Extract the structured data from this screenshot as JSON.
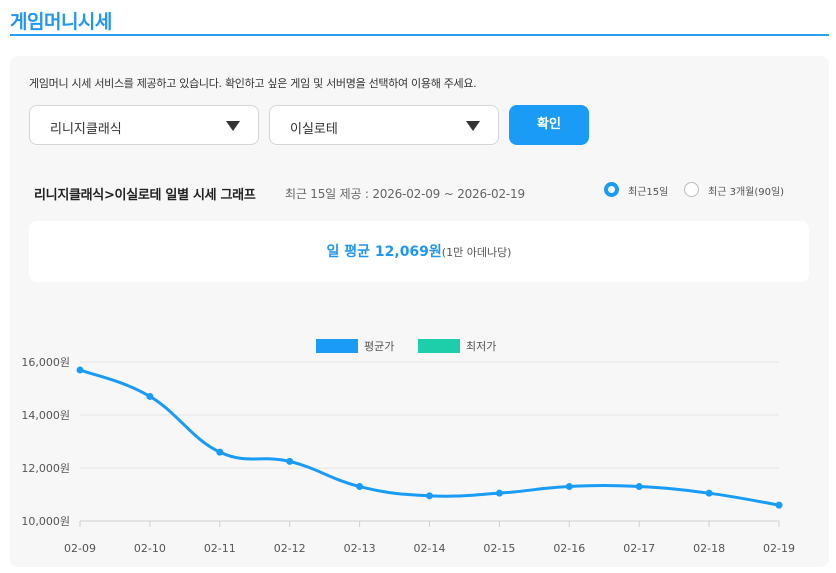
{
  "page": {
    "title": "게임머니시세"
  },
  "panel": {
    "description": "게임머니 시세 서비스를 제공하고 있습니다. 확인하고 싶은 게임 및 서버명을 선택하여 이용해 주세요.",
    "game_select": {
      "value": "리니지클래식"
    },
    "server_select": {
      "value": "이실로테"
    },
    "confirm_label": "확인"
  },
  "graph": {
    "title": "리니지클래식>이실로테 일별 시세 그래프",
    "subtitle": "최근 15일 제공 : 2026-02-09 ~ 2026-02-19",
    "radio_15": "최근15일",
    "radio_90": "최근 3개월(90일)",
    "selected_range": "최근15일"
  },
  "average": {
    "main": "일 평균 12,069원",
    "unit": "(1만 아데나당)"
  },
  "chart_data": {
    "type": "line",
    "x": [
      "02-09",
      "02-10",
      "02-11",
      "02-12",
      "02-13",
      "02-14",
      "02-15",
      "02-16",
      "02-17",
      "02-18",
      "02-19"
    ],
    "series": [
      {
        "name": "평균가",
        "color": "#1a9bf6",
        "values": [
          15700,
          14700,
          12600,
          12250,
          11300,
          10950,
          11050,
          11300,
          11300,
          11050,
          10600
        ]
      },
      {
        "name": "최저가",
        "color": "#1ccea9",
        "values": []
      }
    ],
    "yticks": [
      10000,
      12000,
      14000,
      16000
    ],
    "ytick_labels": [
      "10,000원",
      "12,000원",
      "14,000원",
      "16,000원"
    ],
    "ylim": [
      10000,
      16000
    ],
    "grid": true,
    "legend": "top-center"
  }
}
